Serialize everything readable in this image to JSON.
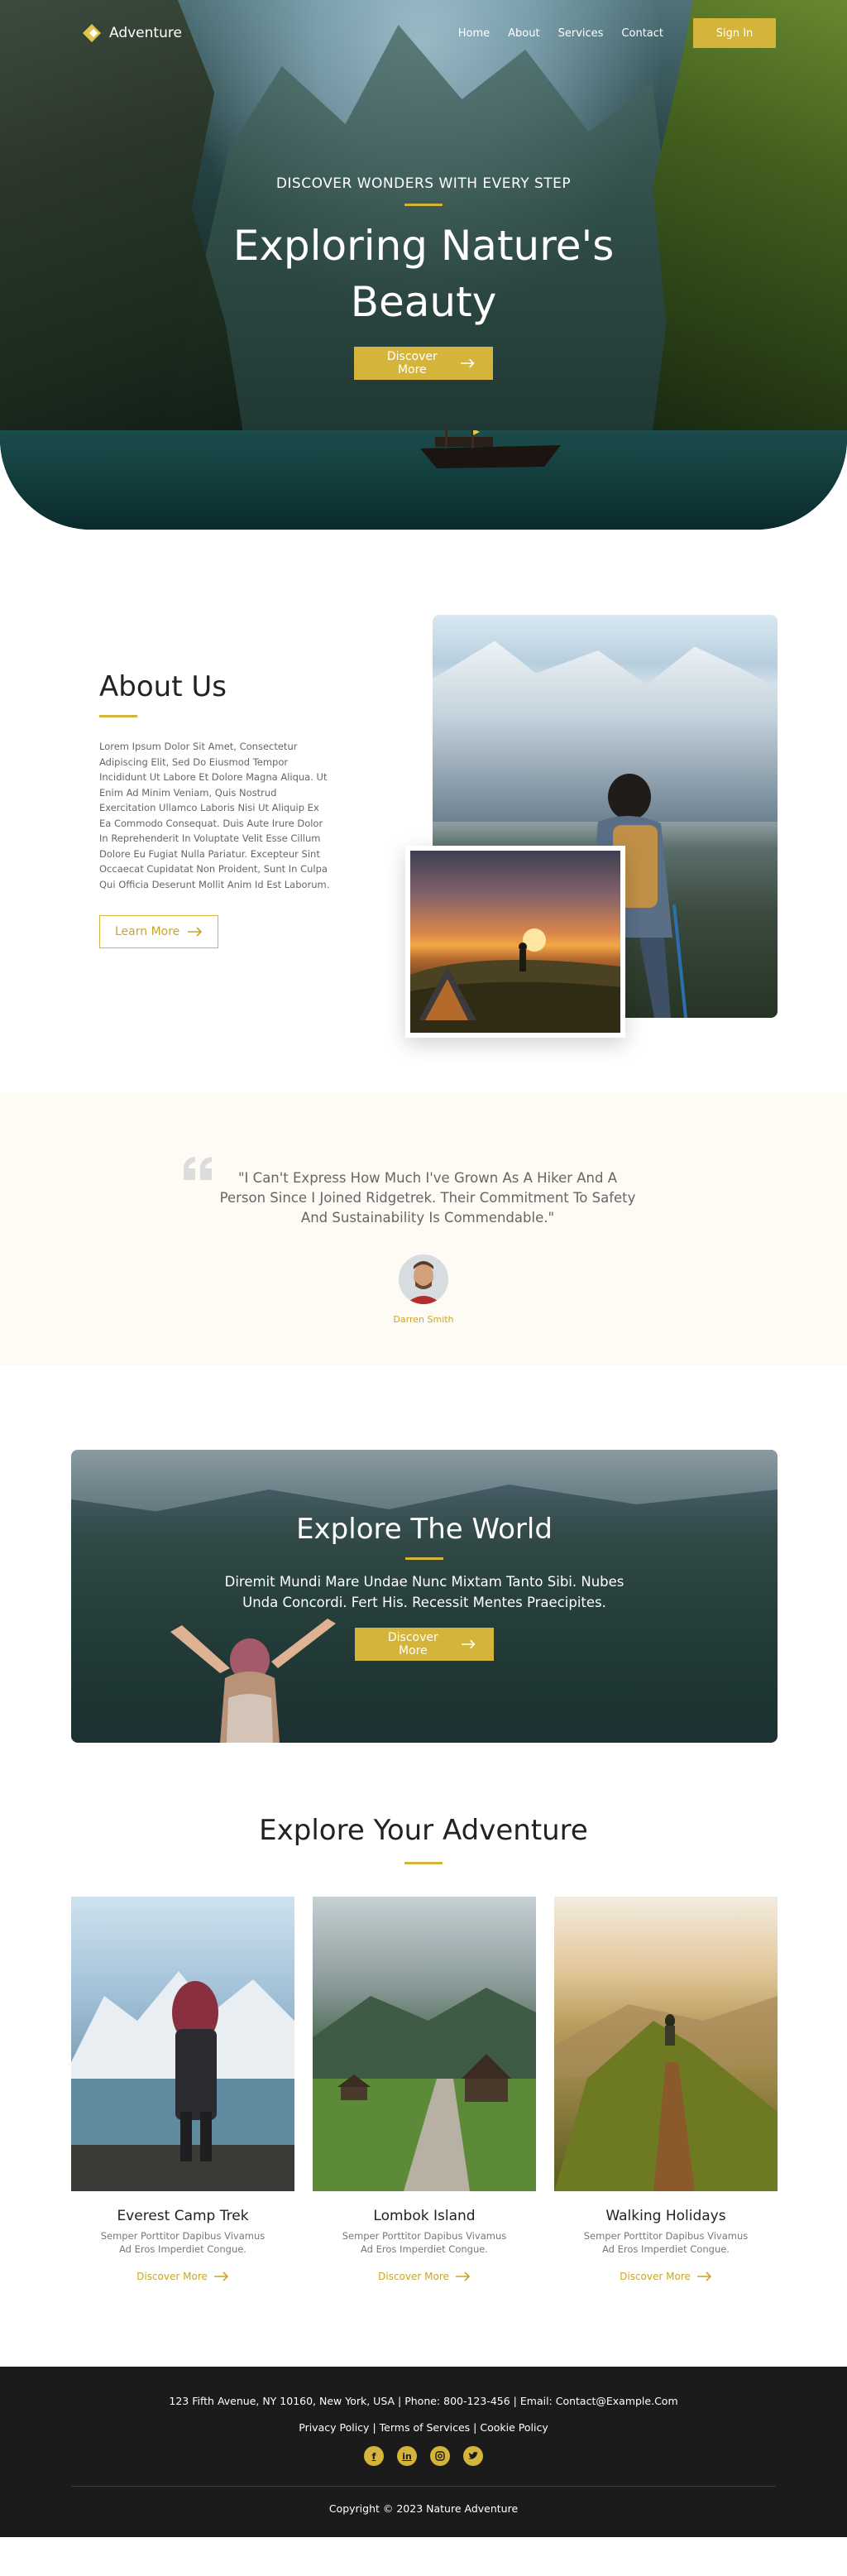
{
  "nav": {
    "brand": "Adventure",
    "links": [
      "Home",
      "About",
      "Services",
      "Contact"
    ],
    "signin_label": "Sign In"
  },
  "hero": {
    "eyebrow": "DISCOVER WONDERS WITH EVERY STEP",
    "title": "Exploring Nature's Beauty",
    "cta_label": "Discover More"
  },
  "about": {
    "title": "About Us",
    "body": "Lorem Ipsum Dolor Sit Amet, Consectetur Adipiscing Elit, Sed Do Eiusmod Tempor Incididunt Ut Labore Et Dolore Magna Aliqua. Ut Enim Ad Minim Veniam, Quis Nostrud Exercitation Ullamco Laboris Nisi Ut Aliquip Ex Ea Commodo Consequat. Duis Aute Irure Dolor In Reprehenderit In Voluptate Velit Esse Cillum Dolore Eu Fugiat Nulla Pariatur. Excepteur Sint Occaecat Cupidatat Non Proident, Sunt In Culpa Qui Officia Deserunt Mollit Anim Id Est Laborum.",
    "cta_label": "Learn More"
  },
  "testimonial": {
    "quote": "\"I Can't Express How Much I've Grown As A Hiker And A Person Since I Joined Ridgetrek. Their Commitment To Safety And Sustainability Is Commendable.\"",
    "author": "Darren Smith"
  },
  "explore_world": {
    "title": "Explore The World",
    "body": "Diremit Mundi Mare Undae Nunc Mixtam Tanto Sibi. Nubes Unda Concordi. Fert His. Recessit Mentes Praecipites.",
    "cta_label": "Discover More"
  },
  "adventure": {
    "title": "Explore Your Adventure",
    "cards": [
      {
        "name": "Everest Camp Trek",
        "desc": "Semper Porttitor Dapibus Vivamus Ad Eros Imperdiet Congue.",
        "link": "Discover More"
      },
      {
        "name": "Lombok Island",
        "desc": "Semper Porttitor Dapibus Vivamus Ad Eros Imperdiet Congue.",
        "link": "Discover More"
      },
      {
        "name": "Walking Holidays",
        "desc": "Semper Porttitor Dapibus Vivamus Ad Eros Imperdiet Congue.",
        "link": "Discover More"
      }
    ]
  },
  "footer": {
    "address": "123 Fifth Avenue, NY 10160, New York, USA | Phone: 800-123-456 | Email: Contact@Example.Com",
    "links": [
      "Privacy Policy",
      "Terms of Services",
      "Cookie Policy"
    ],
    "socials": [
      "facebook-icon",
      "linkedin-icon",
      "instagram-icon",
      "twitter-icon"
    ],
    "copyright": "Copyright © 2023 Nature Adventure"
  },
  "colors": {
    "accent": "#d4b43a",
    "footer_bg": "#1b1b1b",
    "testimonial_bg": "#fdfbf3"
  }
}
